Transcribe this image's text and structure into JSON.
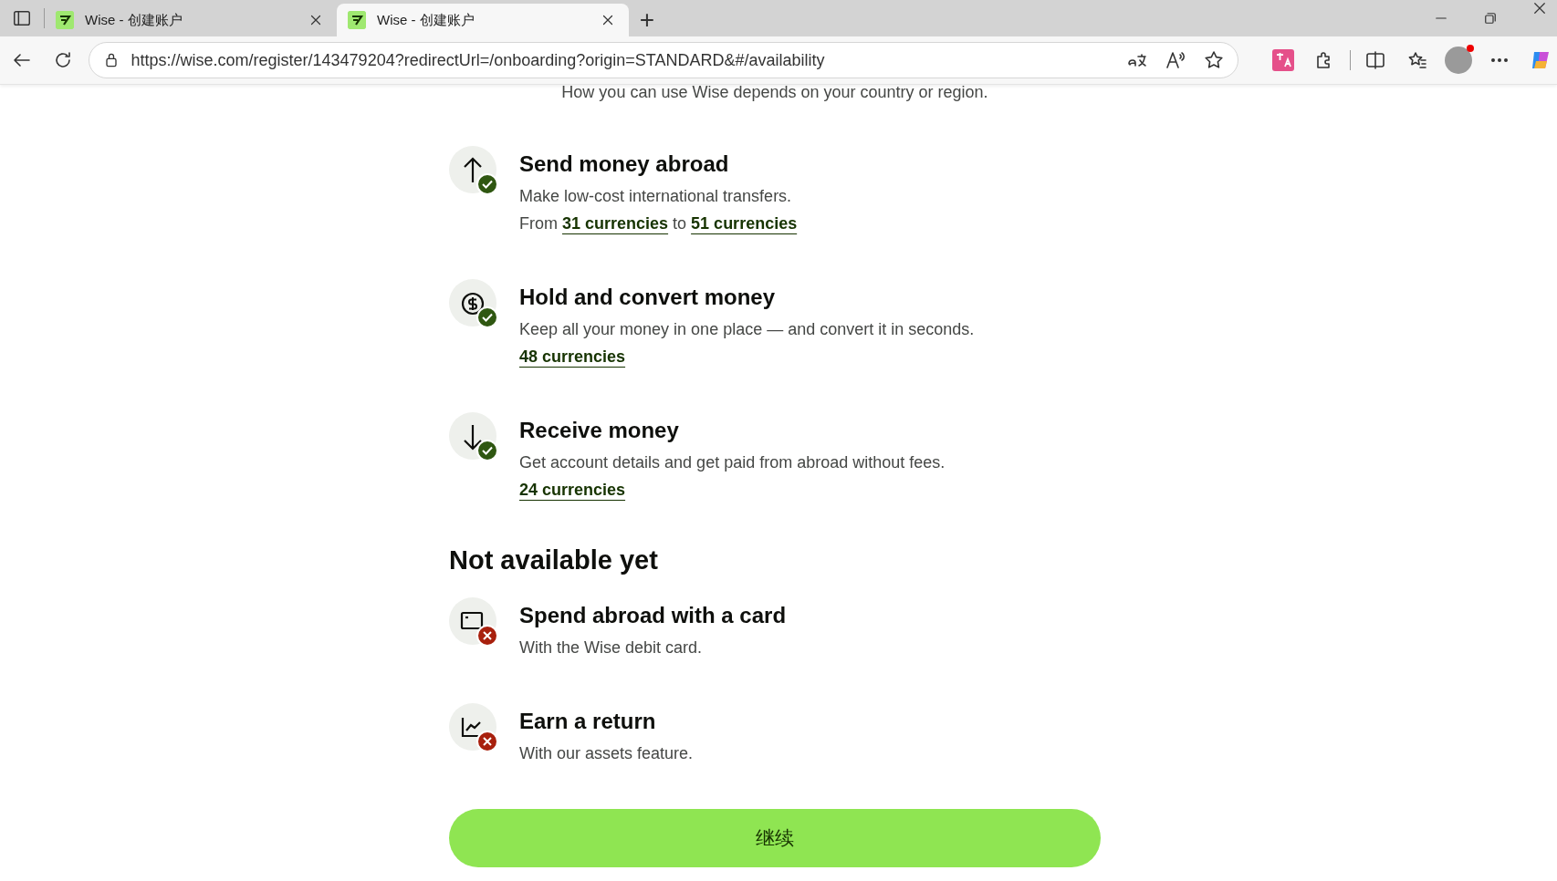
{
  "browser": {
    "tabs": [
      {
        "title": "Wise - 创建账户",
        "selected": false
      },
      {
        "title": "Wise - 创建账户",
        "selected": true
      }
    ],
    "new_tab": "+",
    "url": "https://wise.com/register/143479204?redirectUrl=/onboarding?origin=STANDARD&#/availability"
  },
  "page": {
    "subtitle": "How you can use Wise depends on your country or region.",
    "available": [
      {
        "kind": "arrow-up",
        "available": true,
        "title": "Send money abroad",
        "lines": [
          [
            {
              "kind": "text",
              "text": "Make low-cost international transfers."
            }
          ],
          [
            {
              "kind": "text",
              "text": "From"
            },
            {
              "kind": "link",
              "text": "31 currencies"
            },
            {
              "kind": "text",
              "text": "to"
            },
            {
              "kind": "link",
              "text": "51 currencies"
            }
          ]
        ]
      },
      {
        "kind": "dollar",
        "available": true,
        "title": "Hold and convert money",
        "lines": [
          [
            {
              "kind": "text",
              "text": "Keep all your money in one place — and convert it in seconds."
            }
          ],
          [
            {
              "kind": "link",
              "text": "48 currencies"
            }
          ]
        ]
      },
      {
        "kind": "arrow-down",
        "available": true,
        "title": "Receive money",
        "lines": [
          [
            {
              "kind": "text",
              "text": "Get account details and get paid from abroad without fees."
            }
          ],
          [
            {
              "kind": "link",
              "text": "24 currencies"
            }
          ]
        ]
      }
    ],
    "unavailable_heading": "Not available yet",
    "unavailable": [
      {
        "kind": "card",
        "available": false,
        "title": "Spend abroad with a card",
        "lines": [
          [
            {
              "kind": "text",
              "text": "With the Wise debit card."
            }
          ]
        ]
      },
      {
        "kind": "chart",
        "available": false,
        "title": "Earn a return",
        "lines": [
          [
            {
              "kind": "text",
              "text": "With our assets feature."
            }
          ]
        ]
      }
    ],
    "continue_button": "继续"
  }
}
